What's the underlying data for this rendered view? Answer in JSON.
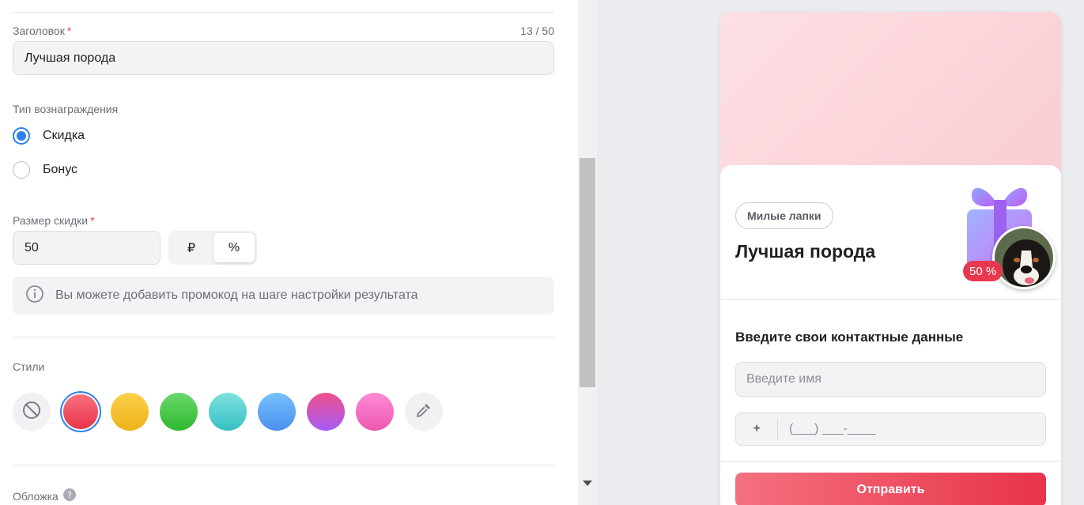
{
  "editor": {
    "title_field": {
      "label": "Заголовок",
      "required_mark": "*",
      "counter": "13 / 50",
      "value": "Лучшая порода"
    },
    "reward_type": {
      "label": "Тип вознаграждения",
      "options": [
        {
          "label": "Скидка",
          "checked": true
        },
        {
          "label": "Бонус",
          "checked": false
        }
      ]
    },
    "discount_size": {
      "label": "Размер скидки",
      "required_mark": "*",
      "value": "50",
      "units": [
        {
          "label": "₽",
          "active": false
        },
        {
          "label": "%",
          "active": true
        }
      ]
    },
    "info_text": "Вы можете добавить промокод на шаге настройки результата",
    "styles": {
      "label": "Стили",
      "swatches": [
        {
          "name": "none",
          "colors": [
            "#f0f1f3"
          ]
        },
        {
          "name": "red",
          "colors": [
            "#f9717f",
            "#e8344a"
          ],
          "selected": true
        },
        {
          "name": "yellow",
          "colors": [
            "#fbd14a",
            "#eeb21b"
          ]
        },
        {
          "name": "green",
          "colors": [
            "#6ad96a",
            "#2fb82f"
          ]
        },
        {
          "name": "teal",
          "colors": [
            "#7fe1df",
            "#35bfc3"
          ]
        },
        {
          "name": "blue",
          "colors": [
            "#75c1fb",
            "#4a8ff0"
          ]
        },
        {
          "name": "violet",
          "colors": [
            "#f04f8c",
            "#a45bf7"
          ]
        },
        {
          "name": "pink",
          "colors": [
            "#ff8ad4",
            "#ec57b1"
          ]
        },
        {
          "name": "eyedropper",
          "colors": [
            "#f0f1f3"
          ]
        }
      ]
    },
    "cover_label": "Обложка"
  },
  "preview": {
    "brand": "Милые лапки",
    "title": "Лучшая порода",
    "badge": "50 %",
    "contact_title": "Введите свои контактные данные",
    "name_placeholder": "Введите имя",
    "phone_prefix": "+",
    "phone_mask": "(___) ___-____",
    "submit_label": "Отправить"
  },
  "colors": {
    "accent": "#2f80ed",
    "brand_red": "#e8344a",
    "badge_red": "#e8384f"
  }
}
